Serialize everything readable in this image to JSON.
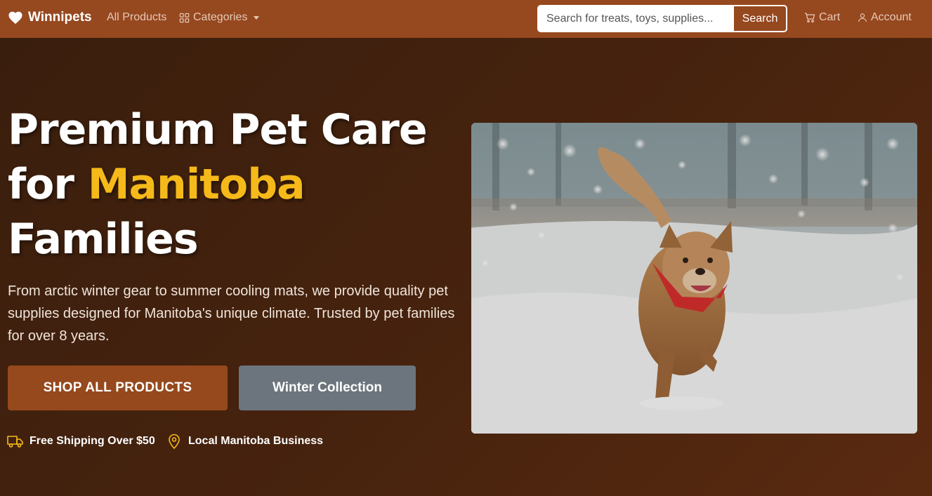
{
  "navbar": {
    "brand": "Winnipets",
    "links": {
      "all_products": "All Products",
      "categories": "Categories"
    },
    "search": {
      "placeholder": "Search for treats, toys, supplies...",
      "button_label": "Search"
    },
    "cart_label": "Cart",
    "account_label": "Account"
  },
  "hero": {
    "title_line1": "Premium Pet Care",
    "title_for": "for",
    "title_accent": "Manitoba",
    "title_line3": "Families",
    "description": "From arctic winter gear to summer cooling mats, we provide quality pet supplies designed for Manitoba's unique climate. Trusted by pet families for over 8 years.",
    "primary_button": "SHOP ALL PRODUCTS",
    "secondary_button": "Winter Collection",
    "features": [
      {
        "icon": "truck-icon",
        "label": "Free Shipping Over $50"
      },
      {
        "icon": "map-pin-icon",
        "label": "Local Manitoba Business"
      }
    ]
  },
  "colors": {
    "navbar": "#96481f",
    "accent": "#f5b91a",
    "primary_button": "#95491d",
    "secondary_button": "#6c757d"
  }
}
